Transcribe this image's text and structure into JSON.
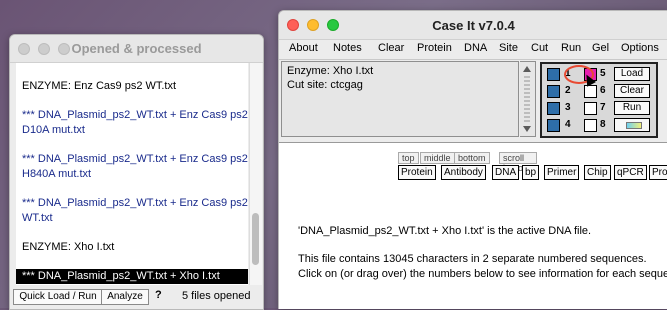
{
  "left_window": {
    "title": "Opened & processed",
    "entries": [
      {
        "text": "ENZYME: Enz Cas9 ps2 WT.txt",
        "style": "plain"
      },
      {
        "text": "*** DNA_Plasmid_ps2_WT.txt + Enz Cas9 ps2",
        "style": "blue"
      },
      {
        "text": "D10A mut.txt",
        "style": "blue"
      },
      {
        "text": "*** DNA_Plasmid_ps2_WT.txt + Enz Cas9 ps2",
        "style": "blue"
      },
      {
        "text": "H840A mut.txt",
        "style": "blue"
      },
      {
        "text": "*** DNA_Plasmid_ps2_WT.txt + Enz Cas9 ps2",
        "style": "blue"
      },
      {
        "text": "WT.txt",
        "style": "blue"
      },
      {
        "text": "ENZYME: Xho I.txt",
        "style": "plain"
      },
      {
        "text": "*** DNA_Plasmid_ps2_WT.txt + Xho I.txt",
        "style": "selected"
      }
    ],
    "quick_load_label": "Quick Load / Run",
    "analyze_label": "Analyze",
    "help_label": "?",
    "files_opened": "5 files opened"
  },
  "right_window": {
    "title": "Case It v7.0.4",
    "menu": [
      "About",
      "Notes",
      "Clear",
      "Protein",
      "DNA",
      "Site",
      "Cut",
      "Run",
      "Gel",
      "Options"
    ],
    "info": {
      "enzyme_line": "Enzyme: Xho I.txt",
      "cut_site_line": "Cut site: ctcgag"
    },
    "lanes": [
      {
        "n": "1"
      },
      {
        "n": "2"
      },
      {
        "n": "3"
      },
      {
        "n": "4"
      },
      {
        "n": "5"
      },
      {
        "n": "6"
      },
      {
        "n": "7"
      },
      {
        "n": "8"
      }
    ],
    "selected_lane": "1",
    "lane_buttons": {
      "load": "Load",
      "clear": "Clear",
      "run": "Run"
    },
    "tabs": [
      "top",
      "middle",
      "bottom",
      "scroll buttons"
    ],
    "tool_buttons": [
      "Protein",
      "Antibody",
      "DNA",
      "bp",
      "Primer",
      "Chip",
      "qPCR",
      "Pro"
    ],
    "messages": {
      "active": "'DNA_Plasmid_ps2_WT.txt + Xho I.txt' is the active DNA file.",
      "contains": "This file contains 13045 characters in 2 separate numbered sequences.",
      "click": "Click on (or drag over) the numbers below to see information for each sequence"
    }
  },
  "colors": {
    "lane_blue": "#2e6ea8",
    "lane_selected": "#e61fb0",
    "highlight_circle": "#e84a32",
    "log_blue_text": "#1a2b8c"
  }
}
